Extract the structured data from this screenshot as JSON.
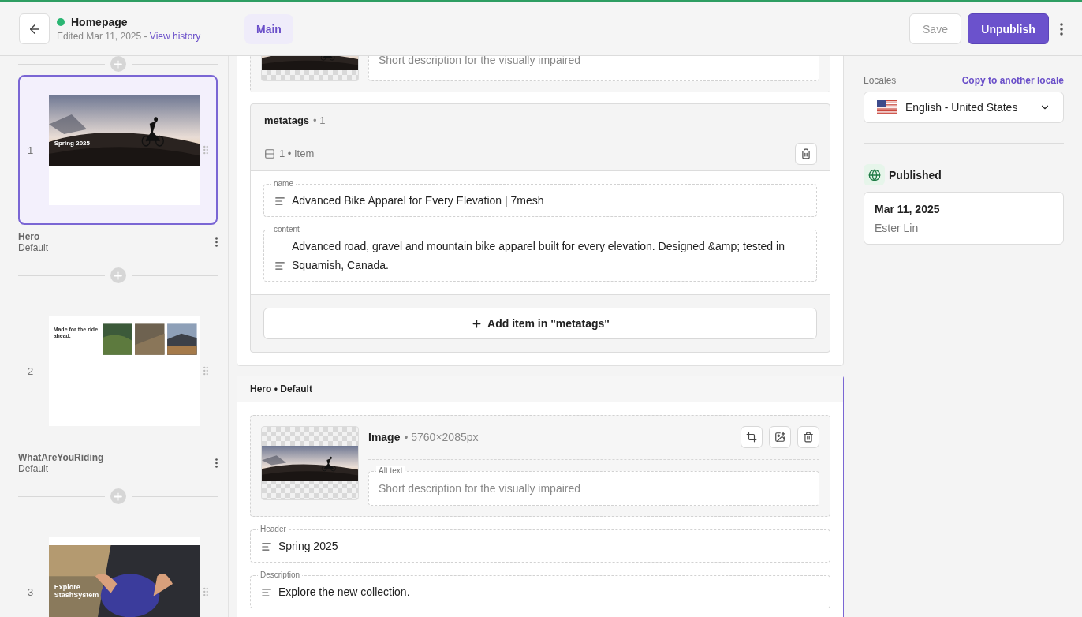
{
  "header": {
    "title": "Homepage",
    "edited": "Edited Mar 11, 2025 - ",
    "history_link": "View history",
    "tabs": [
      {
        "label": "Main",
        "selected": true
      }
    ],
    "save": "Save",
    "publish": "Unpublish"
  },
  "sidebar": {
    "items": [
      {
        "number": "1",
        "title": "Hero",
        "variant": "Default",
        "selected": true,
        "kind": "hero",
        "thumb_title": "Spring 2025"
      },
      {
        "number": "2",
        "title": "WhatAreYouRiding",
        "variant": "Default",
        "selected": false,
        "kind": "grid",
        "thumb_title": "Made for the ride ahead."
      },
      {
        "number": "3",
        "selected": false,
        "kind": "product",
        "thumb_title": "Explore StashSystem"
      }
    ]
  },
  "editor": {
    "top_alt_placeholder": "Short description for the visually impaired",
    "metatags": {
      "title": "metatags",
      "count": "• 1",
      "item_label": "1 • Item",
      "fields": [
        {
          "label": "name",
          "value": "Advanced Bike Apparel for Every Elevation | 7mesh"
        },
        {
          "label": "content",
          "value": "Advanced road, gravel and mountain bike apparel built for every elevation. Designed &amp; tested in Squamish, Canada."
        }
      ],
      "add": "Add item in \"metatags\""
    },
    "hero": {
      "title": "Hero • Default",
      "image_label": "Image",
      "image_size": "• 5760×2085px",
      "alt_label": "Alt text",
      "alt_placeholder": "Short description for the visually impaired",
      "fields": [
        {
          "label": "Header",
          "value": "Spring 2025"
        },
        {
          "label": "Description",
          "value": "Explore the new collection."
        }
      ]
    }
  },
  "right": {
    "locales_label": "Locales",
    "copy_link": "Copy to another locale",
    "locale": "English - United States",
    "status": "Published",
    "date": "Mar 11, 2025",
    "author": "Ester Lin"
  }
}
